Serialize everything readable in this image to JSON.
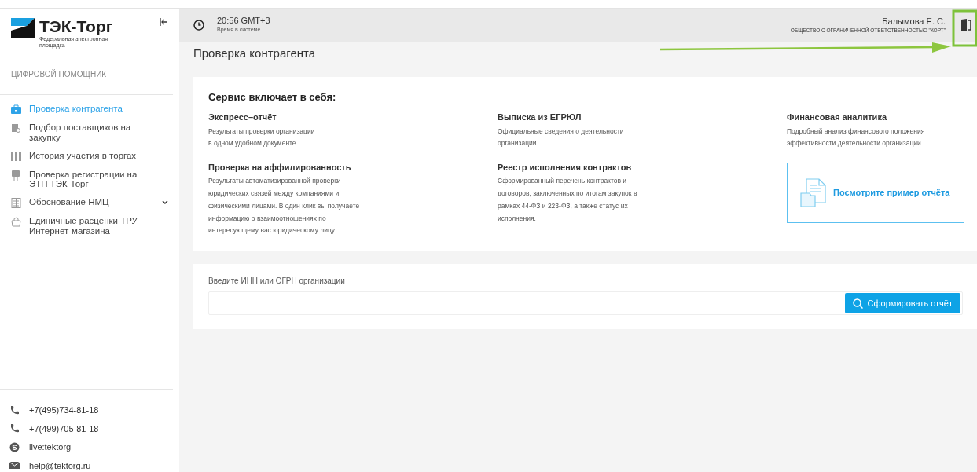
{
  "sidebar": {
    "logo": {
      "name": "ТЭК-Торг",
      "subtitle": "Федеральная электронная площадка"
    },
    "section_title": "ЦИФРОВОЙ ПОМОЩНИК",
    "items": [
      {
        "label": "Проверка контрагента",
        "selected": true
      },
      {
        "label": "Подбор поставщиков на закупку",
        "selected": false
      },
      {
        "label": "История участия в торгах",
        "selected": false
      },
      {
        "label": "Проверка регистрации на ЭТП ТЭК-Торг",
        "selected": false
      },
      {
        "label": "Обоснование НМЦ",
        "selected": false,
        "expanded": false
      },
      {
        "label": "Единичные расценки ТРУ Интернет-магазина",
        "selected": false
      }
    ],
    "contacts": [
      {
        "kind": "phone",
        "text": "+7(495)734-81-18"
      },
      {
        "kind": "phone",
        "text": "+7(499)705-81-18"
      },
      {
        "kind": "skype",
        "text": "live:tektorg"
      },
      {
        "kind": "mail",
        "text": "help@tektorg.ru"
      }
    ]
  },
  "header": {
    "time": "20:56 GMT+3",
    "time_caption": "Время в системе",
    "user": "Балымова Е. С.",
    "company": "ОБЩЕСТВО С ОГРАНИЧЕННОЙ ОТВЕТСТВЕННОСТЬЮ \"КОРТ\""
  },
  "page_title": "Проверка контрагента",
  "services": {
    "title": "Сервис включает в себя:",
    "items": [
      {
        "title": "Экспресс–отчёт",
        "text": "Результаты проверки организации\nв одном удобном документе."
      },
      {
        "title": "Выписка из ЕГРЮЛ",
        "text": "Официальные сведения о деятельности\nорганизации."
      },
      {
        "title": "Финансовая аналитика",
        "text": "Подробный анализ финансового положения\nэффективности деятельности организации."
      },
      {
        "title": "Проверка на аффилированность",
        "text": "Результаты автоматизированной проверки\nюридических связей между компаниями и\nфизическими лицами. В один клик вы получаете\nинформацию о взаимоотношениях по\nинтересующему вас юридическому лицу."
      },
      {
        "title": "Реестр исполнения контрактов",
        "text": "Сформированный перечень контрактов и\nдоговоров, заключенных по итогам закупок в\nрамках 44-ФЗ и 223-ФЗ, а также статус их\nисполнения."
      }
    ],
    "sample_link": "Посмотрите пример отчёта"
  },
  "search": {
    "label": "Введите ИНН или ОГРН организации",
    "button": "Сформировать отчёт"
  }
}
